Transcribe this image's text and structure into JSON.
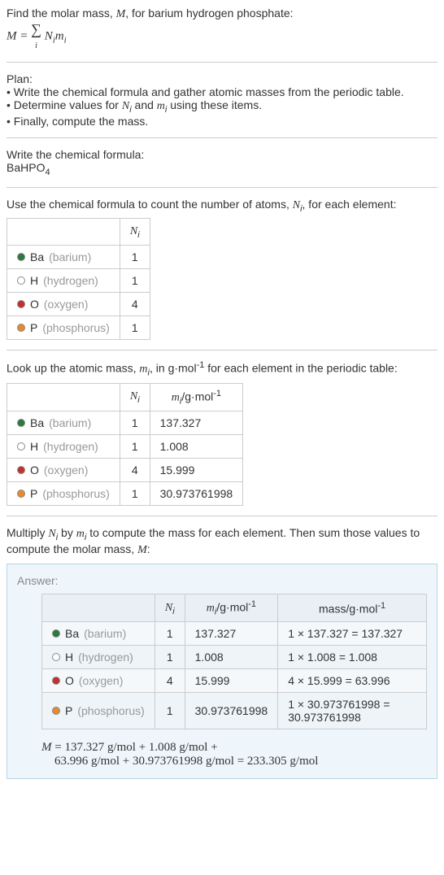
{
  "intro": {
    "line1": "Find the molar mass, ",
    "var_M": "M",
    "line1_cont": ", for barium hydrogen phosphate:",
    "formula_lhs": "M",
    "formula_eq": " = ",
    "formula_sum": "∑",
    "formula_sub": "i",
    "formula_rhs1": " N",
    "formula_rhs1_sub": "i",
    "formula_rhs2": "m",
    "formula_rhs2_sub": "i"
  },
  "plan": {
    "title": "Plan:",
    "items": [
      "Write the chemical formula and gather atomic masses from the periodic table.",
      "Determine values for Nᵢ and mᵢ using these items.",
      "Finally, compute the mass."
    ],
    "item2_prefix": "Determine values for ",
    "item2_n": "N",
    "item2_i1": "i",
    "item2_mid": " and ",
    "item2_m": "m",
    "item2_i2": "i",
    "item2_suffix": " using these items."
  },
  "chemFormula": {
    "label": "Write the chemical formula:",
    "value_prefix": "BaHPO",
    "value_sub": "4"
  },
  "countAtoms": {
    "label_prefix": "Use the chemical formula to count the number of atoms, ",
    "label_n": "N",
    "label_i": "i",
    "label_suffix": ", for each element:",
    "header_n": "N",
    "header_i": "i"
  },
  "elements": [
    {
      "color": "#2a7a3a",
      "symbol": "Ba",
      "name": "(barium)",
      "n": "1",
      "m": "137.327",
      "mass": "1 × 137.327 = 137.327"
    },
    {
      "color": "#ffffff",
      "symbol": "H",
      "name": "(hydrogen)",
      "n": "1",
      "m": "1.008",
      "mass": "1 × 1.008 = 1.008"
    },
    {
      "color": "#c23030",
      "symbol": "O",
      "name": "(oxygen)",
      "n": "4",
      "m": "15.999",
      "mass": "4 × 15.999 = 63.996"
    },
    {
      "color": "#e68a2e",
      "symbol": "P",
      "name": "(phosphorus)",
      "n": "1",
      "m": "30.973761998",
      "mass": "1 × 30.973761998 = 30.973761998"
    }
  ],
  "lookup": {
    "label_prefix": "Look up the atomic mass, ",
    "label_m": "m",
    "label_i": "i",
    "label_mid": ", in g·mol",
    "label_sup": "-1",
    "label_suffix": " for each element in the periodic table:",
    "header_n": "N",
    "header_ni": "i",
    "header_m": "m",
    "header_mi": "i",
    "header_unit": "/g·mol",
    "header_sup": "-1"
  },
  "multiply": {
    "label_prefix": "Multiply ",
    "label_n": "N",
    "label_i1": "i",
    "label_mid": " by ",
    "label_m": "m",
    "label_i2": "i",
    "label_suffix": " to compute the mass for each element. Then sum those values to compute the molar mass, ",
    "label_M": "M",
    "label_end": ":"
  },
  "answer": {
    "label": "Answer:",
    "header_n": "N",
    "header_ni": "i",
    "header_m": "m",
    "header_mi": "i",
    "header_unit": "/g·mol",
    "header_sup": "-1",
    "header_mass": "mass/g·mol",
    "header_mass_sup": "-1",
    "final_M": "M",
    "final_eq": " = 137.327 g/mol + 1.008 g/mol + ",
    "final_line2": "63.996 g/mol + 30.973761998 g/mol = 233.305 g/mol"
  }
}
